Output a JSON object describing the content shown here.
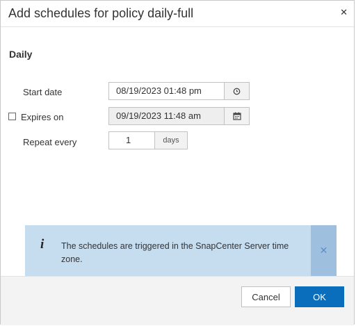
{
  "dialog": {
    "title": "Add schedules for policy daily-full",
    "close_icon": "close-icon",
    "section_title": "Daily"
  },
  "form": {
    "start_date": {
      "label": "Start date",
      "value": "08/19/2023 01:48 pm",
      "icon": "clock-icon"
    },
    "expires_on": {
      "label": "Expires on",
      "checked": false,
      "value": "09/19/2023 11:48 am",
      "icon": "calendar-icon"
    },
    "repeat_every": {
      "label": "Repeat every",
      "value": "1",
      "unit": "days"
    }
  },
  "info": {
    "icon": "info-icon",
    "message": "The schedules are triggered in the SnapCenter Server time zone.",
    "close_icon": "close-icon"
  },
  "footer": {
    "cancel_label": "Cancel",
    "ok_label": "OK"
  },
  "colors": {
    "primary": "#0a6ebd",
    "info_bg": "#c6dcef",
    "info_close_bg": "#9fbfde"
  }
}
